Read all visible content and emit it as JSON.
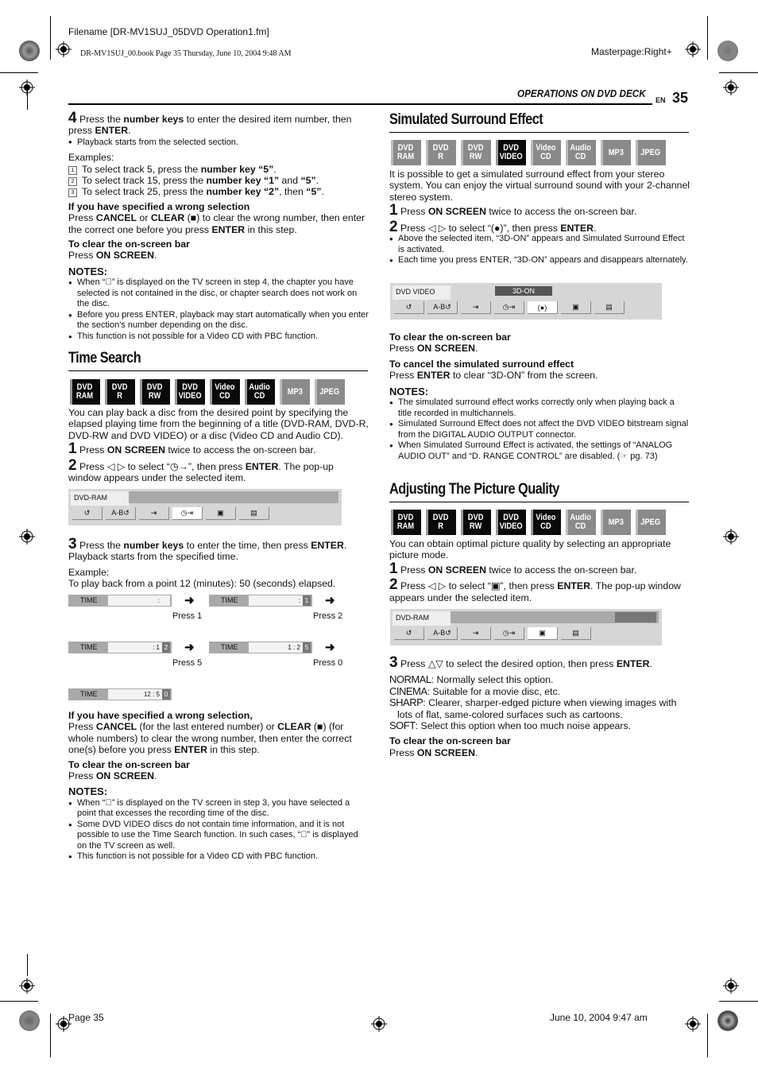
{
  "print_marks": {
    "filename": "Filename [DR-MV1SUJ_05DVD Operation1.fm]",
    "book_line": "DR-MV1SUJ_00.book  Page 35  Thursday, June 10, 2004  9:48 AM",
    "masterpage": "Masterpage:Right+",
    "footer_page": "Page 35",
    "footer_date": "June 10, 2004 9:47 am"
  },
  "header": {
    "section": "OPERATIONS ON DVD DECK",
    "lang": "EN",
    "page_number": "35"
  },
  "left": {
    "step4": {
      "num": "4",
      "text_a": "Press the ",
      "bold_a": "number keys",
      "text_b": " to enter the desired item number, then press ",
      "bold_b": "ENTER",
      "text_c": ".",
      "bullet": "Playback starts from the selected section."
    },
    "examples_label": "Examples:",
    "examples": [
      {
        "n": "1",
        "pre": "To select track 5, press the ",
        "bold": "number key “5”",
        "post": "."
      },
      {
        "n": "2",
        "pre": "To select track 15, press the ",
        "bold": "number key “1”",
        "mid": " and ",
        "bold2": "“5”",
        "post": "."
      },
      {
        "n": "3",
        "pre": "To select track 25, press the ",
        "bold": "number key “2”",
        "mid": ", then ",
        "bold2": "“5”",
        "post": "."
      }
    ],
    "wrong_sel": {
      "heading": "If you have specified a wrong selection",
      "t1": "Press ",
      "b1": "CANCEL",
      "t2": " or ",
      "b2": "CLEAR",
      "t3": " (■) to clear the wrong number, then enter the correct one before you press ",
      "b3": "ENTER",
      "t4": " in this step."
    },
    "clear_bar": {
      "heading": "To clear the on-screen bar",
      "t1": "Press ",
      "b1": "ON SCREEN",
      "t2": "."
    },
    "notes1": {
      "heading": "NOTES:",
      "items": [
        "When “⃠” is displayed on the TV screen in step 4, the chapter you have selected is not contained in the disc, or chapter search does not work on the disc.",
        "Before you press ENTER, playback may start automatically when you enter the section's number depending on the disc.",
        "This function is not possible for a Video CD with PBC function."
      ]
    },
    "time_search": {
      "title": "Time Search",
      "badges": [
        {
          "l1": "DVD",
          "l2": "RAM",
          "state": "on"
        },
        {
          "l1": "DVD",
          "l2": "R",
          "state": "on"
        },
        {
          "l1": "DVD",
          "l2": "RW",
          "state": "on"
        },
        {
          "l1": "DVD",
          "l2": "VIDEO",
          "state": "on"
        },
        {
          "l1": "Video",
          "l2": "CD",
          "state": "on"
        },
        {
          "l1": "Audio",
          "l2": "CD",
          "state": "on"
        },
        {
          "l1": "MP3",
          "l2": "",
          "state": "off"
        },
        {
          "l1": "JPEG",
          "l2": "",
          "state": "off"
        }
      ],
      "intro": "You can play back a disc from the desired point by specifying the elapsed playing time from the beginning of a title (DVD-RAM, DVD-R, DVD-RW and DVD VIDEO) or a disc (Video CD and Audio CD).",
      "step1": {
        "num": "1",
        "t1": "Press ",
        "b1": "ON SCREEN",
        "t2": " twice to access the on-screen bar."
      },
      "step2": {
        "num": "2",
        "t1": "Press ◁ ▷ to select “◷→”, then press ",
        "b1": "ENTER",
        "t2": ". The pop-up window appears under the selected item."
      },
      "osd": {
        "mode": "DVD-RAM",
        "buttons": [
          "↺",
          "A-B↺",
          "⇥",
          "◷⇥",
          "▣",
          "▤"
        ],
        "selected": 3
      },
      "step3": {
        "num": "3",
        "t1": "Press the ",
        "b1": "number keys",
        "t2": " to enter the time, then press ",
        "b2": "ENTER",
        "t3": ". Playback starts from the specified time."
      },
      "example_label": "Example:",
      "example_text": "To play back from a point 12 (minutes): 50 (seconds) elapsed.",
      "time_boxes": [
        {
          "label": "TIME",
          "value": ":",
          "cursor": "",
          "caption": "Press 1"
        },
        {
          "label": "TIME",
          "value": ":",
          "cursor": "1",
          "caption": "Press 2"
        },
        {
          "label": "TIME",
          "value": ": 1",
          "cursor": "2",
          "caption": "Press 5"
        },
        {
          "label": "TIME",
          "value": "1 : 2",
          "cursor": "5",
          "caption": "Press 0"
        },
        {
          "label": "TIME",
          "value": "12 : 5",
          "cursor": "0",
          "caption": ""
        }
      ],
      "wrong_sel": {
        "heading": "If you have specified a wrong selection,",
        "t1": "Press ",
        "b1": "CANCEL",
        "t2": " (for the last entered number) or ",
        "b2": "CLEAR",
        "t3": " (■) (for whole numbers) to clear the wrong number, then enter the correct one(s) before you press ",
        "b3": "ENTER",
        "t4": " in this step."
      },
      "clear_bar": {
        "heading": "To clear the on-screen bar",
        "t1": "Press ",
        "b1": "ON SCREEN",
        "t2": "."
      },
      "notes": {
        "heading": "NOTES:",
        "items": [
          "When “⃠” is displayed on the TV screen in step 3, you have selected a point that excesses the recording time of the disc.",
          "Some DVD VIDEO discs do not contain time information, and it is not possible to use the Time Search function. In such cases, “⃠” is displayed on the TV screen as well.",
          "This function is not possible for a Video CD with PBC function."
        ]
      }
    }
  },
  "right": {
    "surround": {
      "title": "Simulated Surround Effect",
      "badges": [
        {
          "l1": "DVD",
          "l2": "RAM",
          "state": "off"
        },
        {
          "l1": "DVD",
          "l2": "R",
          "state": "off"
        },
        {
          "l1": "DVD",
          "l2": "RW",
          "state": "off"
        },
        {
          "l1": "DVD",
          "l2": "VIDEO",
          "state": "on"
        },
        {
          "l1": "Video",
          "l2": "CD",
          "state": "off"
        },
        {
          "l1": "Audio",
          "l2": "CD",
          "state": "off"
        },
        {
          "l1": "MP3",
          "l2": "",
          "state": "off"
        },
        {
          "l1": "JPEG",
          "l2": "",
          "state": "off"
        }
      ],
      "intro": "It is possible to get a simulated surround effect from your stereo system. You can enjoy the virtual surround sound with your 2-channel stereo system.",
      "step1": {
        "num": "1",
        "t1": "Press ",
        "b1": "ON SCREEN",
        "t2": " twice to access the on-screen bar."
      },
      "step2": {
        "num": "2",
        "t1": "Press ◁ ▷ to select “(●)”, then press ",
        "b1": "ENTER",
        "t2": "."
      },
      "bullets": [
        "Above the selected item, “3D-ON” appears and Simulated Surround Effect is activated.",
        "Each time you press ENTER, “3D-ON” appears and disappears alternately."
      ],
      "osd": {
        "mode": "DVD VIDEO",
        "status": "3D-ON",
        "buttons": [
          "↺",
          "A-B↺",
          "⇥",
          "◷⇥",
          "(●)",
          "▣",
          "▤"
        ],
        "selected": 4
      },
      "clear_bar": {
        "heading": "To clear the on-screen bar",
        "t1": "Press ",
        "b1": "ON SCREEN",
        "t2": "."
      },
      "cancel": {
        "heading": "To cancel the simulated surround effect",
        "t1": "Press ",
        "b1": "ENTER",
        "t2": " to clear “3D-ON” from the screen."
      },
      "notes": {
        "heading": "NOTES:",
        "items": [
          "The simulated surround effect works correctly only when playing back a title recorded in multichannels.",
          "Simulated Surround Effect does not affect the DVD VIDEO bitstream signal from the DIGITAL AUDIO OUTPUT connector.",
          "When Simulated Surround Effect is activated, the settings of “ANALOG AUDIO OUT” and “D. RANGE CONTROL” are disabled. (☞ pg. 73)"
        ]
      }
    },
    "picture": {
      "title": "Adjusting The Picture Quality",
      "badges": [
        {
          "l1": "DVD",
          "l2": "RAM",
          "state": "on"
        },
        {
          "l1": "DVD",
          "l2": "R",
          "state": "on"
        },
        {
          "l1": "DVD",
          "l2": "RW",
          "state": "on"
        },
        {
          "l1": "DVD",
          "l2": "VIDEO",
          "state": "on"
        },
        {
          "l1": "Video",
          "l2": "CD",
          "state": "on"
        },
        {
          "l1": "Audio",
          "l2": "CD",
          "state": "off"
        },
        {
          "l1": "MP3",
          "l2": "",
          "state": "off"
        },
        {
          "l1": "JPEG",
          "l2": "",
          "state": "off"
        }
      ],
      "intro": "You can obtain optimal picture quality by selecting an appropriate picture mode.",
      "step1": {
        "num": "1",
        "t1": "Press ",
        "b1": "ON SCREEN",
        "t2": " twice to access the on-screen bar."
      },
      "step2": {
        "num": "2",
        "t1": "Press ◁ ▷ to select “▣”, then press ",
        "b1": "ENTER",
        "t2": ". The pop-up window appears under the selected item."
      },
      "osd": {
        "mode": "DVD-RAM",
        "buttons": [
          "↺",
          "A-B↺",
          "⇥",
          "◷⇥",
          "▣",
          "▤"
        ],
        "selected": 4
      },
      "step3": {
        "num": "3",
        "t1": "Press △▽ to select the desired option, then press ",
        "b1": "ENTER",
        "t2": "."
      },
      "options": [
        {
          "name": "NORMAL",
          "desc": ": Normally select this option."
        },
        {
          "name": "CINEMA",
          "desc": ": Suitable for a movie disc, etc."
        },
        {
          "name": "SHARP",
          "desc": ": Clearer, sharper-edged picture when viewing images with lots of flat, same-colored surfaces such as cartoons."
        },
        {
          "name": "SOFT",
          "desc": ": Select this option when too much noise appears."
        }
      ],
      "clear_bar": {
        "heading": "To clear the on-screen bar",
        "t1": "Press ",
        "b1": "ON SCREEN",
        "t2": "."
      }
    }
  }
}
